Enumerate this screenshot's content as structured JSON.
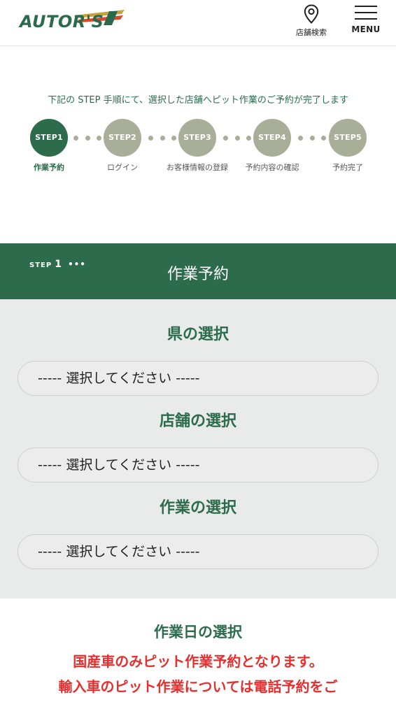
{
  "header": {
    "logo_text": "AUTOR'S",
    "shop_search_label": "店舗検索",
    "menu_label": "MENU"
  },
  "steps": {
    "intro": "下記の STEP 手順にて、選択した店舗へピット作業のご予約が完了します",
    "items": [
      {
        "badge": "STEP1",
        "label": "作業予約",
        "active": true
      },
      {
        "badge": "STEP2",
        "label": "ログイン",
        "active": false
      },
      {
        "badge": "STEP3",
        "label": "お客様情報の登録",
        "active": false
      },
      {
        "badge": "STEP4",
        "label": "予約内容の確認",
        "active": false
      },
      {
        "badge": "STEP5",
        "label": "予約完了",
        "active": false
      }
    ]
  },
  "section": {
    "step_prefix": "STEP",
    "step_number": "1",
    "step_dots": "•••",
    "title": "作業予約"
  },
  "form": {
    "prefecture_label": "県の選択",
    "prefecture_value": "----- 選択してください -----",
    "store_label": "店舗の選択",
    "store_value": "----- 選択してください -----",
    "work_label": "作業の選択",
    "work_value": "----- 選択してください -----"
  },
  "date_section": {
    "title": "作業日の選択",
    "notice_line1": "国産車のみピット作業予約となります。",
    "notice_line2": "輸入車のピット作業については電話予約をご"
  },
  "colors": {
    "brand_green": "#2d6b4d",
    "step_inactive": "#a8ae98",
    "notice_red": "#e62e2e",
    "form_bg": "#e8ebea"
  }
}
